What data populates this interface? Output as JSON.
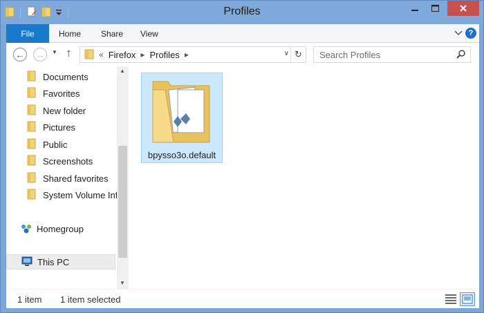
{
  "window": {
    "title": "Profiles"
  },
  "ribbon": {
    "file_label": "File",
    "tabs": [
      {
        "label": "Home"
      },
      {
        "label": "Share"
      },
      {
        "label": "View"
      }
    ],
    "help_label": "?"
  },
  "address_bar": {
    "overflow": "«",
    "crumbs": [
      {
        "label": "Firefox"
      },
      {
        "label": "Profiles"
      }
    ]
  },
  "search": {
    "placeholder": "Search Profiles"
  },
  "nav_pane": {
    "items": [
      {
        "label": "Documents"
      },
      {
        "label": "Favorites"
      },
      {
        "label": "New folder"
      },
      {
        "label": "Pictures"
      },
      {
        "label": "Public"
      },
      {
        "label": "Screenshots"
      },
      {
        "label": "Shared favorites"
      },
      {
        "label": "System Volume Information"
      }
    ],
    "homegroup_label": "Homegroup",
    "thispc_label": "This PC"
  },
  "files": [
    {
      "name": "bpysso3o.default",
      "selected": true
    }
  ],
  "status": {
    "count": "1 item",
    "selected": "1 item selected"
  },
  "colors": {
    "title_bar": "#7ea9da",
    "file_tab": "#1979ca",
    "close_button": "#c75050",
    "selection_fill": "#cce8ff",
    "selection_border": "#99d1ff"
  }
}
